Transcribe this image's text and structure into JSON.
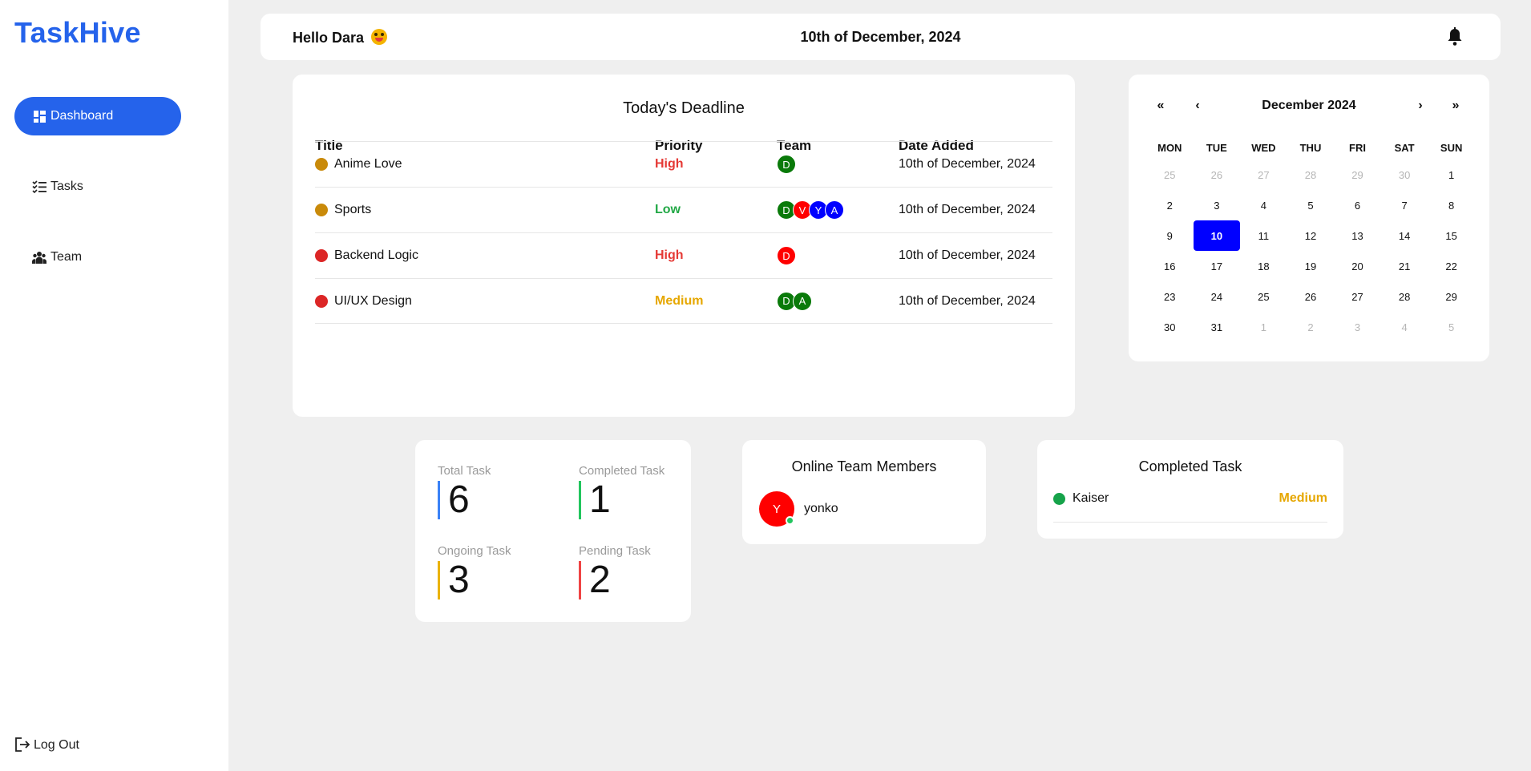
{
  "app": {
    "logo": "TaskHive"
  },
  "sidebar": {
    "items": [
      {
        "label": "Dashboard",
        "icon": "dashboard-icon"
      },
      {
        "label": "Tasks",
        "icon": "tasks-icon"
      },
      {
        "label": "Team",
        "icon": "team-icon"
      }
    ],
    "logout": "Log Out"
  },
  "header": {
    "greeting": "Hello Dara",
    "date": "10th of December, 2024"
  },
  "deadline": {
    "title": "Today's Deadline",
    "columns": {
      "title": "Title",
      "priority": "Priority",
      "team": "Team",
      "date": "Date Added"
    },
    "rows": [
      {
        "title": "Anime Love",
        "dot": "#c98a0a",
        "priority": "High",
        "priority_color": "#e53935",
        "team": [
          "D"
        ],
        "team_colors": [
          "#0a7a0a"
        ],
        "date": "10th of December, 2024"
      },
      {
        "title": "Sports",
        "dot": "#c98a0a",
        "priority": "Low",
        "priority_color": "#22a846",
        "team": [
          "D",
          "V",
          "Y",
          "A"
        ],
        "team_colors": [
          "#0a7a0a",
          "#f00",
          "#0000ff",
          "#0000ff"
        ],
        "date": "10th of December, 2024"
      },
      {
        "title": "Backend Logic",
        "dot": "#dc2626",
        "priority": "High",
        "priority_color": "#e53935",
        "team": [
          "D"
        ],
        "team_colors": [
          "#f00"
        ],
        "date": "10th of December, 2024"
      },
      {
        "title": "UI/UX Design",
        "dot": "#dc2626",
        "priority": "Medium",
        "priority_color": "#e6a700",
        "team": [
          "D",
          "A"
        ],
        "team_colors": [
          "#0a7a0a",
          "#0a7a0a"
        ],
        "date": "10th of December, 2024"
      }
    ]
  },
  "calendar": {
    "month": "December 2024",
    "nav": {
      "prev_year": "«",
      "prev_month": "‹",
      "next_month": "›",
      "next_year": "»"
    },
    "weekdays": [
      "MON",
      "TUE",
      "WED",
      "THU",
      "FRI",
      "SAT",
      "SUN"
    ],
    "days": [
      {
        "d": "25",
        "m": true
      },
      {
        "d": "26",
        "m": true
      },
      {
        "d": "27",
        "m": true
      },
      {
        "d": "28",
        "m": true
      },
      {
        "d": "29",
        "m": true
      },
      {
        "d": "30",
        "m": true
      },
      {
        "d": "1"
      },
      {
        "d": "2"
      },
      {
        "d": "3"
      },
      {
        "d": "4"
      },
      {
        "d": "5"
      },
      {
        "d": "6"
      },
      {
        "d": "7"
      },
      {
        "d": "8"
      },
      {
        "d": "9"
      },
      {
        "d": "10",
        "sel": true
      },
      {
        "d": "11"
      },
      {
        "d": "12"
      },
      {
        "d": "13"
      },
      {
        "d": "14"
      },
      {
        "d": "15"
      },
      {
        "d": "16"
      },
      {
        "d": "17"
      },
      {
        "d": "18"
      },
      {
        "d": "19"
      },
      {
        "d": "20"
      },
      {
        "d": "21"
      },
      {
        "d": "22"
      },
      {
        "d": "23"
      },
      {
        "d": "24"
      },
      {
        "d": "25"
      },
      {
        "d": "26"
      },
      {
        "d": "27"
      },
      {
        "d": "28"
      },
      {
        "d": "29"
      },
      {
        "d": "30"
      },
      {
        "d": "31"
      },
      {
        "d": "1",
        "m": true
      },
      {
        "d": "2",
        "m": true
      },
      {
        "d": "3",
        "m": true
      },
      {
        "d": "4",
        "m": true
      },
      {
        "d": "5",
        "m": true
      }
    ]
  },
  "stats": {
    "total": {
      "label": "Total Task",
      "value": "6",
      "color": "#3b82f6"
    },
    "completed": {
      "label": "Completed Task",
      "value": "1",
      "color": "#22c55e"
    },
    "ongoing": {
      "label": "Ongoing Task",
      "value": "3",
      "color": "#eab308"
    },
    "pending": {
      "label": "Pending Task",
      "value": "2",
      "color": "#ef4444"
    }
  },
  "online": {
    "title": "Online Team Members",
    "member": {
      "initial": "Y",
      "name": "yonko"
    }
  },
  "completed": {
    "title": "Completed Task",
    "item": {
      "title": "Kaiser",
      "priority": "Medium",
      "dot": "#16a34a",
      "priority_color": "#e6a700"
    }
  }
}
